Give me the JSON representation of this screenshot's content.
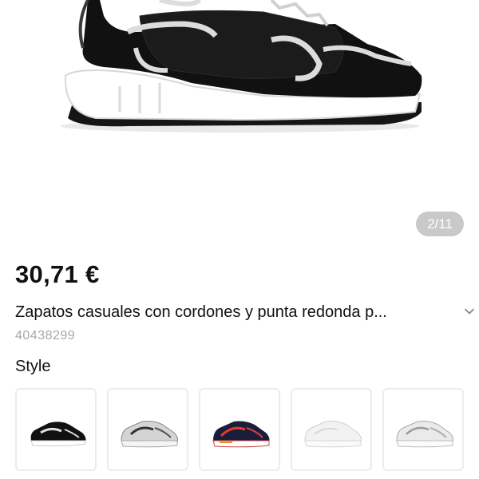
{
  "gallery": {
    "counter": "2/11",
    "image_icon": "sneaker-black-white-image"
  },
  "product": {
    "price": "30,71 €",
    "title": "Zapatos casuales con cordones y punta redonda p...",
    "sku": "40438299",
    "expand_icon": "chevron-down-icon"
  },
  "style": {
    "label": "Style",
    "options": [
      {
        "name": "black-white",
        "selected": true
      },
      {
        "name": "grey-silver",
        "selected": false
      },
      {
        "name": "black-multicolor",
        "selected": false
      },
      {
        "name": "white",
        "selected": false
      },
      {
        "name": "white-silver",
        "selected": false
      }
    ]
  }
}
